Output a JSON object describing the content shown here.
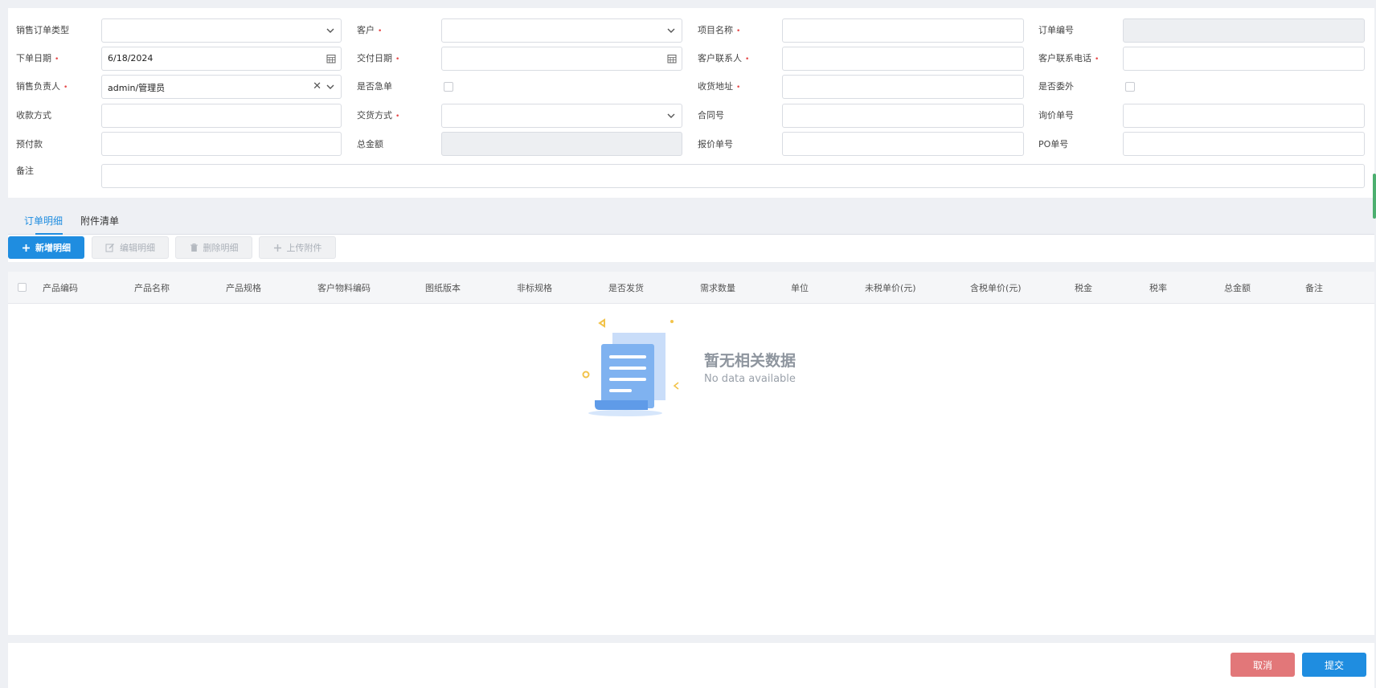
{
  "form": {
    "order_type": {
      "label": "销售订单类型",
      "value": ""
    },
    "customer": {
      "label": "客户",
      "value": ""
    },
    "project_name": {
      "label": "项目名称",
      "value": ""
    },
    "order_no": {
      "label": "订单编号",
      "value": ""
    },
    "order_date": {
      "label": "下单日期",
      "value": "6/18/2024"
    },
    "delivery_date": {
      "label": "交付日期",
      "value": ""
    },
    "customer_contact": {
      "label": "客户联系人",
      "value": ""
    },
    "customer_phone": {
      "label": "客户联系电话",
      "value": ""
    },
    "sales_person": {
      "label": "销售负责人",
      "value": "admin/管理员"
    },
    "urgent": {
      "label": "是否急单",
      "checked": false
    },
    "ship_address": {
      "label": "收货地址",
      "value": ""
    },
    "outsource": {
      "label": "是否委外",
      "checked": false
    },
    "payment_method": {
      "label": "收款方式",
      "value": ""
    },
    "delivery_method": {
      "label": "交货方式",
      "value": ""
    },
    "contract_no": {
      "label": "合同号",
      "value": ""
    },
    "inquiry_no": {
      "label": "询价单号",
      "value": ""
    },
    "prepayment": {
      "label": "预付款",
      "value": ""
    },
    "total_amount": {
      "label": "总金额",
      "value": ""
    },
    "quote_no": {
      "label": "报价单号",
      "value": ""
    },
    "po_no": {
      "label": "PO单号",
      "value": ""
    },
    "remark": {
      "label": "备注",
      "value": ""
    },
    "required_mark": "•"
  },
  "tabs": [
    {
      "label": "订单明细",
      "active": true
    },
    {
      "label": "附件清单",
      "active": false
    }
  ],
  "toolbar": {
    "add": "新增明细",
    "edit": "编辑明细",
    "delete": "删除明细",
    "upload": "上传附件"
  },
  "table": {
    "columns": [
      "产品编码",
      "产品名称",
      "产品规格",
      "客户物料编码",
      "图纸版本",
      "非标规格",
      "是否发货",
      "需求数量",
      "单位",
      "未税单价(元)",
      "含税单价(元)",
      "税金",
      "税率",
      "总金额",
      "备注"
    ],
    "rows": [],
    "empty_title": "暂无相关数据",
    "empty_subtitle": "No data available"
  },
  "footer": {
    "cancel": "取消",
    "submit": "提交"
  },
  "colors": {
    "primary": "#1f8de0",
    "cancel": "#e27779",
    "required": "#e64a4a"
  },
  "icons": [
    "chevron-down-icon",
    "calendar-icon",
    "clear-icon",
    "plus-icon",
    "edit-icon",
    "trash-icon",
    "empty-document-illustration"
  ]
}
